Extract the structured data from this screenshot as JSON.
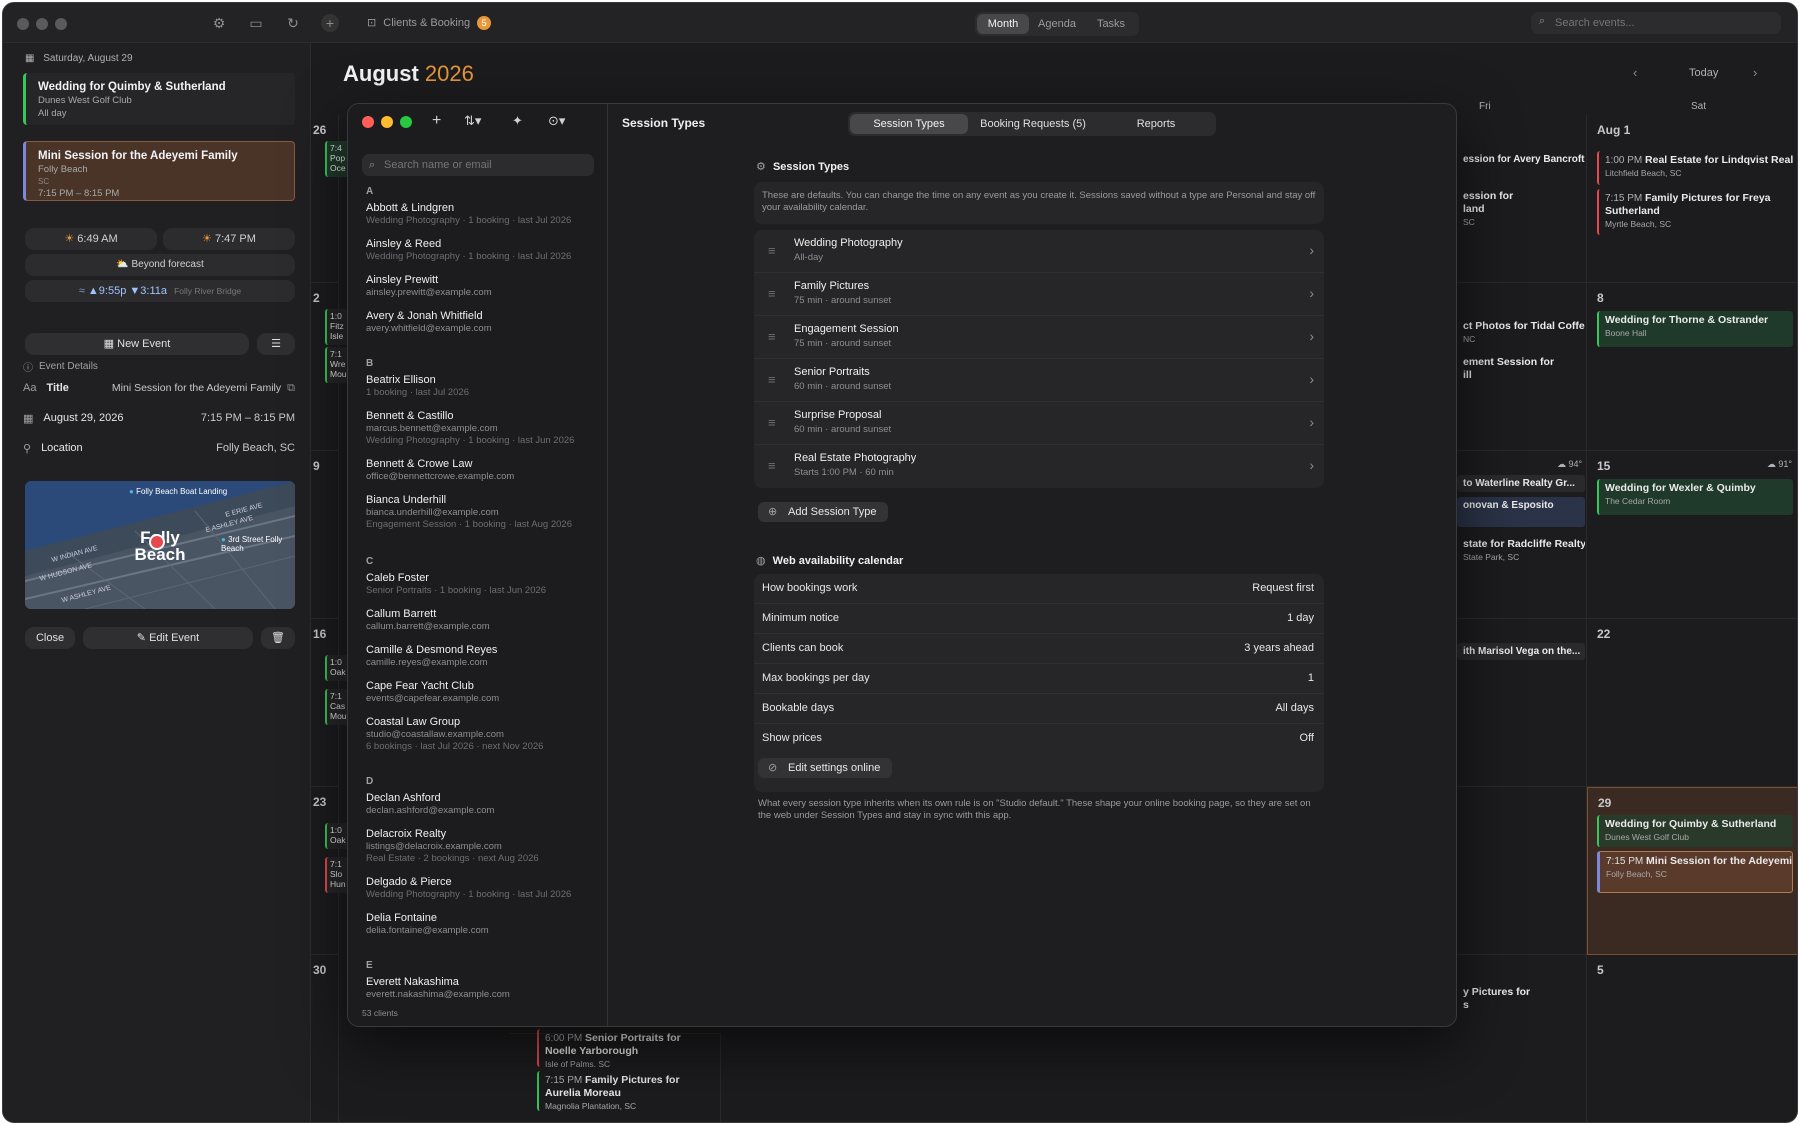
{
  "topbar": {
    "calendar_label": "Clients & Booking",
    "calendar_badge": "5",
    "views": [
      "Month",
      "Agenda",
      "Tasks"
    ],
    "search_placeholder": "Search events..."
  },
  "header": {
    "month": "August",
    "year": "2026",
    "today": "Today",
    "days": [
      "Fri",
      "Sat"
    ]
  },
  "sidebar": {
    "date": "Saturday, August 29",
    "event1": {
      "title": "Wedding for Quimby & Sutherland",
      "venue": "Dunes West Golf Club",
      "time": "All day"
    },
    "event2": {
      "title": "Mini Session for the Adeyemi Family",
      "venue": "Folly Beach",
      "region": "SC",
      "time": "7:15 PM – 8:15 PM"
    },
    "sunrise": "6:49 AM",
    "sunset": "7:47 PM",
    "forecast": "Beyond forecast",
    "tide_high": "▲9:55p",
    "tide_low": "▼3:11a",
    "tide_place": "Folly River Bridge",
    "new_event": "New Event",
    "details_header": "Event Details",
    "title_label": "Title",
    "title_value": "Mini Session for the Adeyemi Family",
    "date_value": "August 29, 2026",
    "time_value": "7:15 PM – 8:15 PM",
    "location_label": "Location",
    "location_value": "Folly Beach, SC",
    "map": {
      "place": "Folly Beach",
      "landmark1": "Folly Beach Boat Landing",
      "landmark2": "3rd Street Folly Beach",
      "road1": "E ERIE AVE",
      "road2": "E ASHLEY AVE",
      "road3": "W INDIAN AVE",
      "road4": "W HUDSON AVE",
      "road5": "W ASHLEY AVE"
    },
    "close": "Close",
    "edit": "Edit Event"
  },
  "calendar": {
    "weeks": [
      "26",
      "2",
      "9",
      "16",
      "23",
      "30"
    ],
    "sat_dates": [
      "Aug 1",
      "8",
      "15",
      "22",
      "29",
      "5"
    ],
    "temp1": "94°",
    "temp2": "91°",
    "left_fragments": [
      "7:4",
      "Pop",
      "Oce",
      "1:0",
      "Fitz",
      "Isle",
      "7:1",
      "Wre",
      "Mou",
      "1:0",
      "Oak",
      "7:1",
      "Cas",
      "Mou",
      "1:0",
      "Oak",
      "7:1",
      "Slo",
      "Hun"
    ],
    "fri_events": [
      "ession for Avery Bancroft",
      "ession for",
      "land",
      "SC",
      "ct Photos for Tidal Coffee",
      "NC",
      "ement Session for",
      "ill",
      "to Waterline Realty Gr...",
      "onovan & Esposito",
      "state for Radcliffe Realty",
      "State Park, SC",
      "ith Marisol Vega on the...",
      "y Pictures for",
      "s"
    ],
    "sat_events": {
      "e1_time": "1:00 PM",
      "e1_title": "Real Estate for Lindqvist Realty",
      "e1_sub": "Litchfield Beach, SC",
      "e2_time": "7:15 PM",
      "e2_title": "Family Pictures for Freya Sutherland",
      "e2_sub": "Myrtle Beach, SC",
      "e3_title": "Wedding for Thorne & Ostrander",
      "e3_sub": "Boone Hall",
      "e4_title": "Wedding for Wexler & Quimby",
      "e4_sub": "The Cedar Room",
      "e5_title": "Wedding for Quimby & Sutherland",
      "e5_sub": "Dunes West Golf Club",
      "e6_time": "7:15 PM",
      "e6_title": "Mini Session for the Adeyemi Family",
      "e6_sub": "Folly Beach, SC"
    },
    "bottom_events": {
      "b1_time": "6:00 PM",
      "b1_title": "Senior Portraits for Noelle Yarborough",
      "b1_sub": "Isle of Palms, SC",
      "b2_time": "7:15 PM",
      "b2_title": "Family Pictures for Aurelia Moreau",
      "b2_sub": "Magnolia Plantation, SC"
    }
  },
  "modal": {
    "title": "Session Types",
    "tabs": [
      "Session Types",
      "Booking Requests (5)",
      "Reports"
    ],
    "search_placeholder": "Search name or email",
    "client_count": "53 clients",
    "letters": [
      "A",
      "B",
      "C",
      "D",
      "E"
    ],
    "clients": [
      {
        "name": "Abbott & Lindgren",
        "line2": "Wedding Photography · 1 booking · last Jul 2026",
        "line3": ""
      },
      {
        "name": "Ainsley & Reed",
        "line2": "Wedding Photography · 1 booking · last Jul 2026",
        "line3": ""
      },
      {
        "name": "Ainsley Prewitt",
        "line2": "ainsley.prewitt@example.com",
        "line3": ""
      },
      {
        "name": "Avery & Jonah Whitfield",
        "line2": "avery.whitfield@example.com",
        "line3": ""
      },
      {
        "name": "Beatrix Ellison",
        "line2": "1 booking · last Jul 2026",
        "line3": ""
      },
      {
        "name": "Bennett & Castillo",
        "line2": "marcus.bennett@example.com",
        "line3": "Wedding Photography · 1 booking · last Jun 2026"
      },
      {
        "name": "Bennett & Crowe Law",
        "line2": "office@bennettcrowe.example.com",
        "line3": ""
      },
      {
        "name": "Bianca Underhill",
        "line2": "bianca.underhill@example.com",
        "line3": "Engagement Session · 1 booking · last Aug 2026"
      },
      {
        "name": "Caleb Foster",
        "line2": "Senior Portraits · 1 booking · last Jun 2026",
        "line3": ""
      },
      {
        "name": "Callum Barrett",
        "line2": "callum.barrett@example.com",
        "line3": ""
      },
      {
        "name": "Camille & Desmond Reyes",
        "line2": "camille.reyes@example.com",
        "line3": ""
      },
      {
        "name": "Cape Fear Yacht Club",
        "line2": "events@capefear.example.com",
        "line3": ""
      },
      {
        "name": "Coastal Law Group",
        "line2": "studio@coastallaw.example.com",
        "line3": "6 bookings · last Jul 2026 · next Nov 2026"
      },
      {
        "name": "Declan Ashford",
        "line2": "declan.ashford@example.com",
        "line3": ""
      },
      {
        "name": "Delacroix Realty",
        "line2": "listings@delacroix.example.com",
        "line3": "Real Estate · 2 bookings · next Aug 2026"
      },
      {
        "name": "Delgado & Pierce",
        "line2": "Wedding Photography · 1 booking · last Jul 2026",
        "line3": ""
      },
      {
        "name": "Delia Fontaine",
        "line2": "delia.fontaine@example.com",
        "line3": ""
      },
      {
        "name": "Everett Nakashima",
        "line2": "everett.nakashima@example.com",
        "line3": ""
      }
    ],
    "section1": "Session Types",
    "section1_note": "These are defaults. You can change the time on any event as you create it. Sessions saved without a type are Personal and stay off your availability calendar.",
    "session_types": [
      {
        "name": "Wedding Photography",
        "detail": "All-day"
      },
      {
        "name": "Family Pictures",
        "detail": "75 min · around sunset"
      },
      {
        "name": "Engagement Session",
        "detail": "75 min · around sunset"
      },
      {
        "name": "Senior Portraits",
        "detail": "60 min · around sunset"
      },
      {
        "name": "Surprise Proposal",
        "detail": "60 min · around sunset"
      },
      {
        "name": "Real Estate Photography",
        "detail": "Starts 1:00 PM · 60 min"
      }
    ],
    "add_session": "Add Session Type",
    "section2": "Web availability calendar",
    "availability": [
      {
        "label": "How bookings work",
        "value": "Request first"
      },
      {
        "label": "Minimum notice",
        "value": "1 day"
      },
      {
        "label": "Clients can book",
        "value": "3 years ahead"
      },
      {
        "label": "Max bookings per day",
        "value": "1"
      },
      {
        "label": "Bookable days",
        "value": "All days"
      },
      {
        "label": "Show prices",
        "value": "Off"
      }
    ],
    "edit_online": "Edit settings online",
    "footer_note": "What every session type inherits when its own rule is on \"Studio default.\" These shape your online booking page, so they are set on the web under Session Types and stay in sync with this app."
  },
  "colors": {
    "accent": "#e8973a",
    "green": "#34c759",
    "red": "#e5484d",
    "wedding_bg": "#1f3a2a",
    "selected_bg": "#4a3327"
  }
}
